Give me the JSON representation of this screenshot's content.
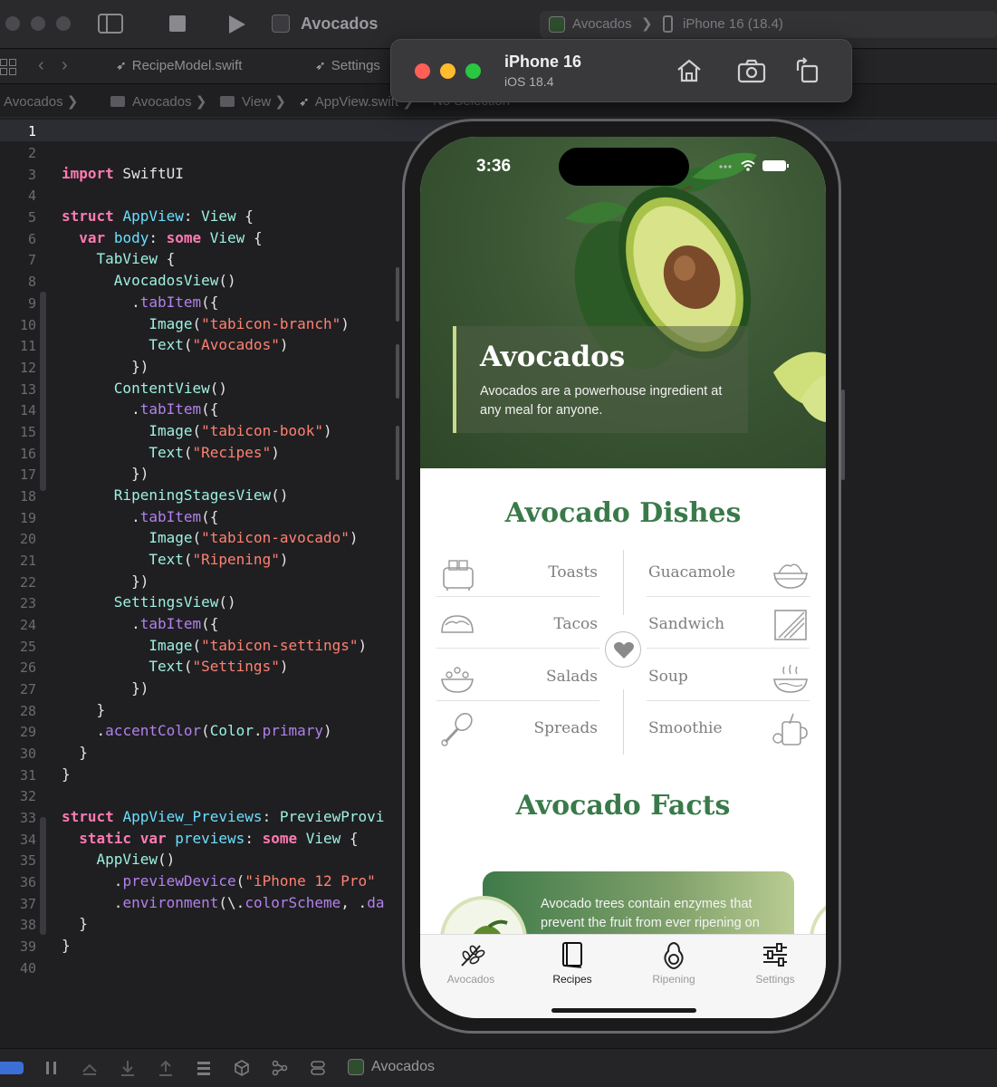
{
  "xcode": {
    "project_title": "Avocados",
    "scheme": {
      "app": "Avocados",
      "separator": "❯",
      "device": "iPhone 16 (18.4)"
    },
    "tabs": [
      {
        "label": "RecipeModel.swift"
      },
      {
        "label": "Settings"
      }
    ],
    "breadcrumbs": [
      {
        "label": "Avocados",
        "sep": "❯"
      },
      {
        "label": "Avocados",
        "sep": "❯"
      },
      {
        "label": "View",
        "sep": "❯"
      },
      {
        "label": "AppView.swift",
        "sep": "❯"
      },
      {
        "label": "No Selection",
        "sep": ""
      }
    ],
    "line_numbers": [
      "1",
      "2",
      "3",
      "4",
      "5",
      "6",
      "7",
      "8",
      "9",
      "10",
      "11",
      "12",
      "13",
      "14",
      "15",
      "16",
      "17",
      "18",
      "19",
      "20",
      "21",
      "22",
      "23",
      "24",
      "25",
      "26",
      "27",
      "28",
      "29",
      "30",
      "31",
      "32",
      "33",
      "34",
      "35",
      "36",
      "37",
      "38",
      "39",
      "40"
    ],
    "current_line": "1",
    "statusbar_label": "Avocados"
  },
  "simulator": {
    "device_name": "iPhone 16",
    "os_version": "iOS 18.4"
  },
  "app": {
    "status_time": "3:36",
    "hero": {
      "title": "Avocados",
      "subtitle": "Avocados are a powerhouse ingredient at any meal for anyone."
    },
    "dishes_title": "Avocado Dishes",
    "dishes": {
      "left": [
        {
          "label": "Toasts",
          "icon": "toaster-icon"
        },
        {
          "label": "Tacos",
          "icon": "taco-icon"
        },
        {
          "label": "Salads",
          "icon": "salad-icon"
        },
        {
          "label": "Spreads",
          "icon": "whisk-icon"
        }
      ],
      "right": [
        {
          "label": "Guacamole",
          "icon": "bowl-icon"
        },
        {
          "label": "Sandwich",
          "icon": "sandwich-icon"
        },
        {
          "label": "Soup",
          "icon": "soup-icon"
        },
        {
          "label": "Smoothie",
          "icon": "smoothie-icon"
        }
      ]
    },
    "facts_title": "Avocado Facts",
    "fact_text": "Avocado trees contain enzymes that prevent the fruit from ever ripening on",
    "tabs": [
      {
        "label": "Avocados",
        "icon": "branch-icon",
        "active": false
      },
      {
        "label": "Recipes",
        "icon": "book-icon",
        "active": true
      },
      {
        "label": "Ripening",
        "icon": "avocado-icon",
        "active": false
      },
      {
        "label": "Settings",
        "icon": "sliders-icon",
        "active": false
      }
    ]
  },
  "colors": {
    "accent_green": "#3a7a4a",
    "hero_green": "#3b5734",
    "editor_bg": "#1f1f22"
  }
}
